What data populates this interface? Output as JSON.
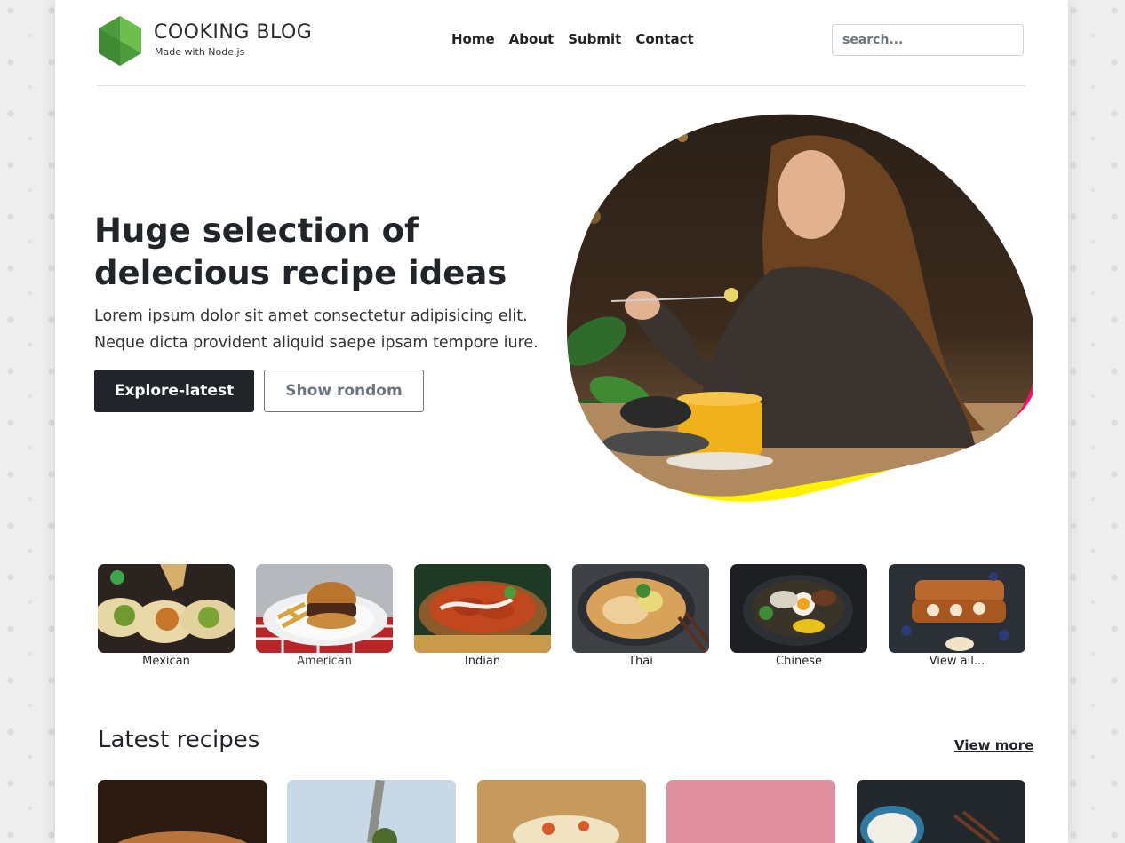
{
  "header": {
    "brand_title": "COOKING BLOG",
    "brand_subtitle": "Made with Node.js",
    "nav": [
      "Home",
      "About",
      "Submit",
      "Contact"
    ],
    "search_placeholder": "search..."
  },
  "hero": {
    "title": "Huge selection of delecious recipe ideas",
    "description": "Lorem ipsum dolor sit amet consectetur adipisicing elit. Neque dicta provident aliquid saepe ipsam tempore iure.",
    "primary_button": "Explore-latest",
    "secondary_button": "Show rondom",
    "blob_accent_colors": [
      "#ff0a6c",
      "#fff200"
    ]
  },
  "categories": [
    {
      "label": "Mexican",
      "icon": "tacos-image"
    },
    {
      "label": "American",
      "icon": "burger-image"
    },
    {
      "label": "Indian",
      "icon": "curry-image"
    },
    {
      "label": "Thai",
      "icon": "noodle-soup-image"
    },
    {
      "label": "Chinese",
      "icon": "ramen-bowl-image"
    },
    {
      "label": "View all...",
      "icon": "french-toast-image"
    }
  ],
  "latest": {
    "title": "Latest recipes",
    "view_more": "View more"
  },
  "colors": {
    "primary_button_bg": "#212529",
    "logo_green": "#5aa945"
  }
}
